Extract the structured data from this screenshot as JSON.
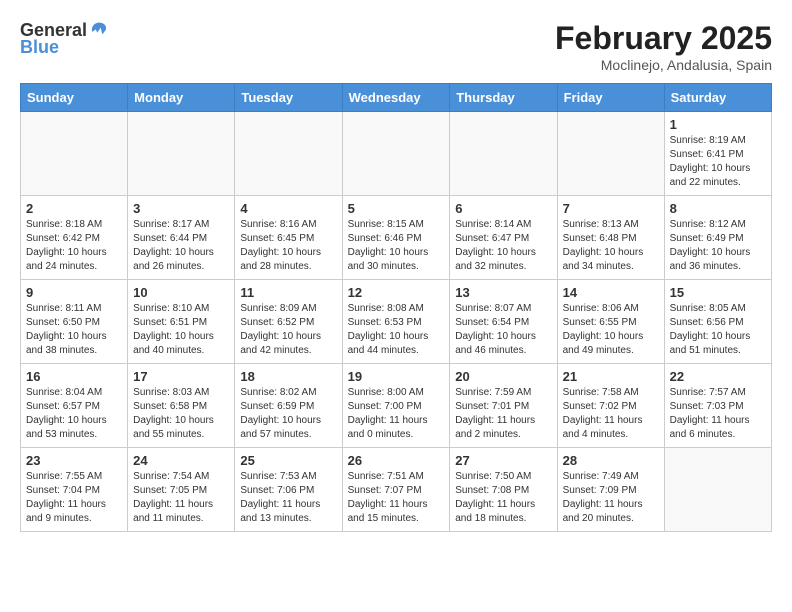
{
  "logo": {
    "general": "General",
    "blue": "Blue"
  },
  "title": {
    "month_year": "February 2025",
    "location": "Moclinejo, Andalusia, Spain"
  },
  "weekdays": [
    "Sunday",
    "Monday",
    "Tuesday",
    "Wednesday",
    "Thursday",
    "Friday",
    "Saturday"
  ],
  "weeks": [
    [
      {
        "day": "",
        "info": ""
      },
      {
        "day": "",
        "info": ""
      },
      {
        "day": "",
        "info": ""
      },
      {
        "day": "",
        "info": ""
      },
      {
        "day": "",
        "info": ""
      },
      {
        "day": "",
        "info": ""
      },
      {
        "day": "1",
        "info": "Sunrise: 8:19 AM\nSunset: 6:41 PM\nDaylight: 10 hours and 22 minutes."
      }
    ],
    [
      {
        "day": "2",
        "info": "Sunrise: 8:18 AM\nSunset: 6:42 PM\nDaylight: 10 hours and 24 minutes."
      },
      {
        "day": "3",
        "info": "Sunrise: 8:17 AM\nSunset: 6:44 PM\nDaylight: 10 hours and 26 minutes."
      },
      {
        "day": "4",
        "info": "Sunrise: 8:16 AM\nSunset: 6:45 PM\nDaylight: 10 hours and 28 minutes."
      },
      {
        "day": "5",
        "info": "Sunrise: 8:15 AM\nSunset: 6:46 PM\nDaylight: 10 hours and 30 minutes."
      },
      {
        "day": "6",
        "info": "Sunrise: 8:14 AM\nSunset: 6:47 PM\nDaylight: 10 hours and 32 minutes."
      },
      {
        "day": "7",
        "info": "Sunrise: 8:13 AM\nSunset: 6:48 PM\nDaylight: 10 hours and 34 minutes."
      },
      {
        "day": "8",
        "info": "Sunrise: 8:12 AM\nSunset: 6:49 PM\nDaylight: 10 hours and 36 minutes."
      }
    ],
    [
      {
        "day": "9",
        "info": "Sunrise: 8:11 AM\nSunset: 6:50 PM\nDaylight: 10 hours and 38 minutes."
      },
      {
        "day": "10",
        "info": "Sunrise: 8:10 AM\nSunset: 6:51 PM\nDaylight: 10 hours and 40 minutes."
      },
      {
        "day": "11",
        "info": "Sunrise: 8:09 AM\nSunset: 6:52 PM\nDaylight: 10 hours and 42 minutes."
      },
      {
        "day": "12",
        "info": "Sunrise: 8:08 AM\nSunset: 6:53 PM\nDaylight: 10 hours and 44 minutes."
      },
      {
        "day": "13",
        "info": "Sunrise: 8:07 AM\nSunset: 6:54 PM\nDaylight: 10 hours and 46 minutes."
      },
      {
        "day": "14",
        "info": "Sunrise: 8:06 AM\nSunset: 6:55 PM\nDaylight: 10 hours and 49 minutes."
      },
      {
        "day": "15",
        "info": "Sunrise: 8:05 AM\nSunset: 6:56 PM\nDaylight: 10 hours and 51 minutes."
      }
    ],
    [
      {
        "day": "16",
        "info": "Sunrise: 8:04 AM\nSunset: 6:57 PM\nDaylight: 10 hours and 53 minutes."
      },
      {
        "day": "17",
        "info": "Sunrise: 8:03 AM\nSunset: 6:58 PM\nDaylight: 10 hours and 55 minutes."
      },
      {
        "day": "18",
        "info": "Sunrise: 8:02 AM\nSunset: 6:59 PM\nDaylight: 10 hours and 57 minutes."
      },
      {
        "day": "19",
        "info": "Sunrise: 8:00 AM\nSunset: 7:00 PM\nDaylight: 11 hours and 0 minutes."
      },
      {
        "day": "20",
        "info": "Sunrise: 7:59 AM\nSunset: 7:01 PM\nDaylight: 11 hours and 2 minutes."
      },
      {
        "day": "21",
        "info": "Sunrise: 7:58 AM\nSunset: 7:02 PM\nDaylight: 11 hours and 4 minutes."
      },
      {
        "day": "22",
        "info": "Sunrise: 7:57 AM\nSunset: 7:03 PM\nDaylight: 11 hours and 6 minutes."
      }
    ],
    [
      {
        "day": "23",
        "info": "Sunrise: 7:55 AM\nSunset: 7:04 PM\nDaylight: 11 hours and 9 minutes."
      },
      {
        "day": "24",
        "info": "Sunrise: 7:54 AM\nSunset: 7:05 PM\nDaylight: 11 hours and 11 minutes."
      },
      {
        "day": "25",
        "info": "Sunrise: 7:53 AM\nSunset: 7:06 PM\nDaylight: 11 hours and 13 minutes."
      },
      {
        "day": "26",
        "info": "Sunrise: 7:51 AM\nSunset: 7:07 PM\nDaylight: 11 hours and 15 minutes."
      },
      {
        "day": "27",
        "info": "Sunrise: 7:50 AM\nSunset: 7:08 PM\nDaylight: 11 hours and 18 minutes."
      },
      {
        "day": "28",
        "info": "Sunrise: 7:49 AM\nSunset: 7:09 PM\nDaylight: 11 hours and 20 minutes."
      },
      {
        "day": "",
        "info": ""
      }
    ]
  ]
}
